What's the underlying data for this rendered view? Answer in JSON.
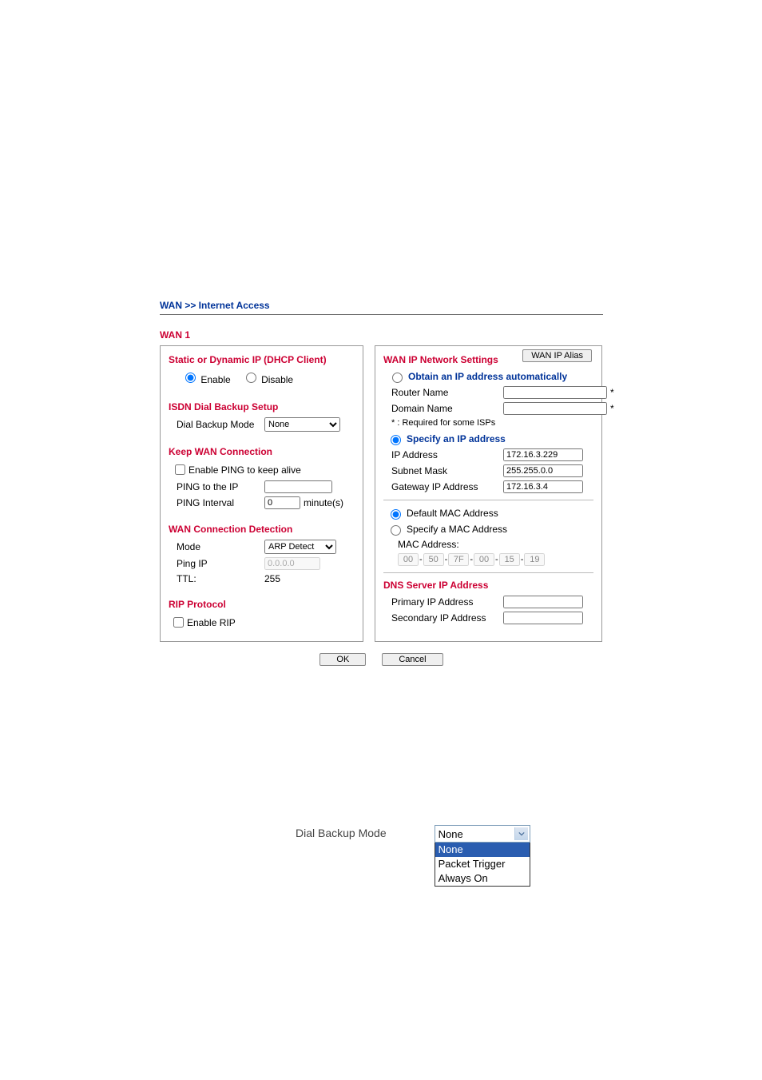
{
  "breadcrumb": "WAN >> Internet Access",
  "wan_title": "WAN 1",
  "left": {
    "static_title": "Static or Dynamic IP (DHCP Client)",
    "enable_label": "Enable",
    "disable_label": "Disable",
    "isdn_title": "ISDN Dial Backup Setup",
    "dial_backup_mode_label": "Dial Backup Mode",
    "dial_backup_mode_value": "None",
    "keep_title": "Keep WAN Connection",
    "enable_ping_label": "Enable PING to keep alive",
    "ping_to_label": "PING to the IP",
    "ping_to_value": "",
    "ping_interval_label": "PING Interval",
    "ping_interval_value": "0",
    "ping_interval_unit": "minute(s)",
    "detect_title": "WAN Connection Detection",
    "detect_mode_label": "Mode",
    "detect_mode_value": "ARP Detect",
    "ping_ip_label": "Ping IP",
    "ping_ip_value": "0.0.0.0",
    "ttl_label": "TTL:",
    "ttl_value": "255",
    "rip_title": "RIP Protocol",
    "enable_rip_label": "Enable RIP"
  },
  "right": {
    "net_settings_title": "WAN IP Network Settings",
    "alias_btn": "WAN IP Alias",
    "obtain_label": "Obtain an IP address automatically",
    "router_name_label": "Router Name",
    "router_name_value": "",
    "domain_name_label": "Domain Name",
    "domain_name_value": "",
    "note_required": "* : Required for some ISPs",
    "specify_label": "Specify an IP address",
    "ip_address_label": "IP Address",
    "ip_address_value": "172.16.3.229",
    "subnet_label": "Subnet Mask",
    "subnet_value": "255.255.0.0",
    "gateway_label": "Gateway IP Address",
    "gateway_value": "172.16.3.4",
    "default_mac_label": "Default MAC Address",
    "specify_mac_label": "Specify a MAC Address",
    "mac_address_label": "MAC Address:",
    "mac": [
      "00",
      "50",
      "7F",
      "00",
      "15",
      "19"
    ],
    "dns_title": "DNS Server IP Address",
    "primary_label": "Primary IP Address",
    "primary_value": "",
    "secondary_label": "Secondary IP Address",
    "secondary_value": ""
  },
  "buttons": {
    "ok": "OK",
    "cancel": "Cancel"
  },
  "dropdown": {
    "label": "Dial Backup Mode",
    "selected": "None",
    "options": [
      "None",
      "Packet Trigger",
      "Always On"
    ]
  }
}
